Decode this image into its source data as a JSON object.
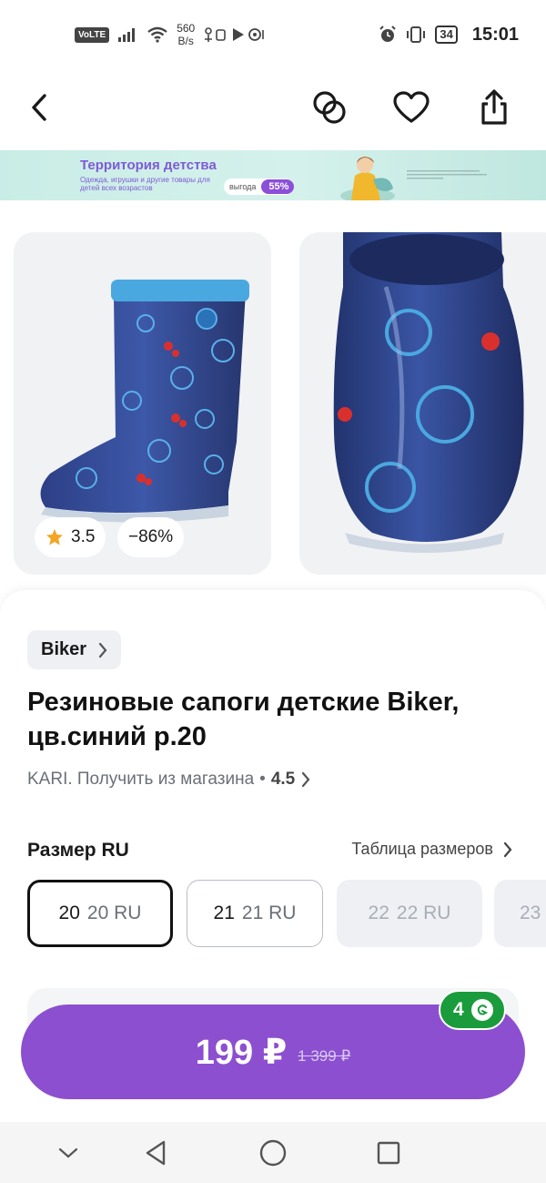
{
  "status_bar": {
    "volte": "VoLTE",
    "net_speed_value": "560",
    "net_speed_unit": "B/s",
    "battery": "34",
    "time": "15:01"
  },
  "header": {
    "back_icon": "chevron-left-icon",
    "compare_icon": "compare-circles-icon",
    "favorite_icon": "heart-icon",
    "share_icon": "share-icon"
  },
  "banner": {
    "title": "Территория детства",
    "subtitle": "Одежда, игрушки и другие товары для детей всех возрастов",
    "benefit_label": "выгода",
    "benefit_percent": "55%"
  },
  "gallery": {
    "rating": "3.5",
    "discount": "−86%",
    "accent_star": "#f5a524"
  },
  "product": {
    "brand": "Biker",
    "title": "Резиновые сапоги детские Biker, цв.синий р.20",
    "seller": "KARI. Получить из магазина",
    "seller_sep": "•",
    "seller_rating": "4.5"
  },
  "sizes": {
    "label": "Размер RU",
    "table_link": "Таблица размеров",
    "options": [
      {
        "size": "20",
        "ru": "20 RU",
        "state": "selected"
      },
      {
        "size": "21",
        "ru": "21 RU",
        "state": "available"
      },
      {
        "size": "22",
        "ru": "22 RU",
        "state": "unavailable"
      },
      {
        "size": "23",
        "ru": "",
        "state": "unavailable"
      }
    ]
  },
  "buy": {
    "price": "199 ₽",
    "old_price": "1 399 ₽",
    "bonus": "4",
    "accent": "#8b4fd0",
    "bonus_color": "#1a9b3c"
  },
  "nav": {
    "icons": [
      "chevron-down-icon",
      "back-triangle-icon",
      "home-circle-icon",
      "recents-square-icon"
    ]
  }
}
